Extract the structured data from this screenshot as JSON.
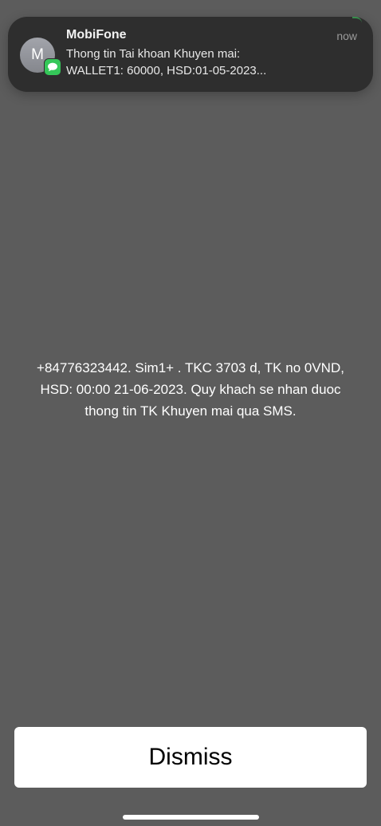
{
  "notification": {
    "sender": "MobiFone",
    "avatar_initial": "M",
    "time": "now",
    "preview_line1": "Thong tin Tai khoan Khuyen mai:",
    "preview_line2": "WALLET1: 60000, HSD:01-05-2023...",
    "badge_icon": "messages-icon",
    "badge_color": "#35c759"
  },
  "message": {
    "line1": "+84776323442. Sim1+ . TKC 3703 d, TK no 0VND,",
    "line2": "HSD: 00:00 21-06-2023. Quy khach se nhan duoc",
    "line3": "thong tin TK Khuyen mai qua SMS."
  },
  "dismiss_label": "Dismiss",
  "colors": {
    "background": "#5c5c5c",
    "notification_bg": "#2e2e2e",
    "button_bg": "#ffffff"
  }
}
